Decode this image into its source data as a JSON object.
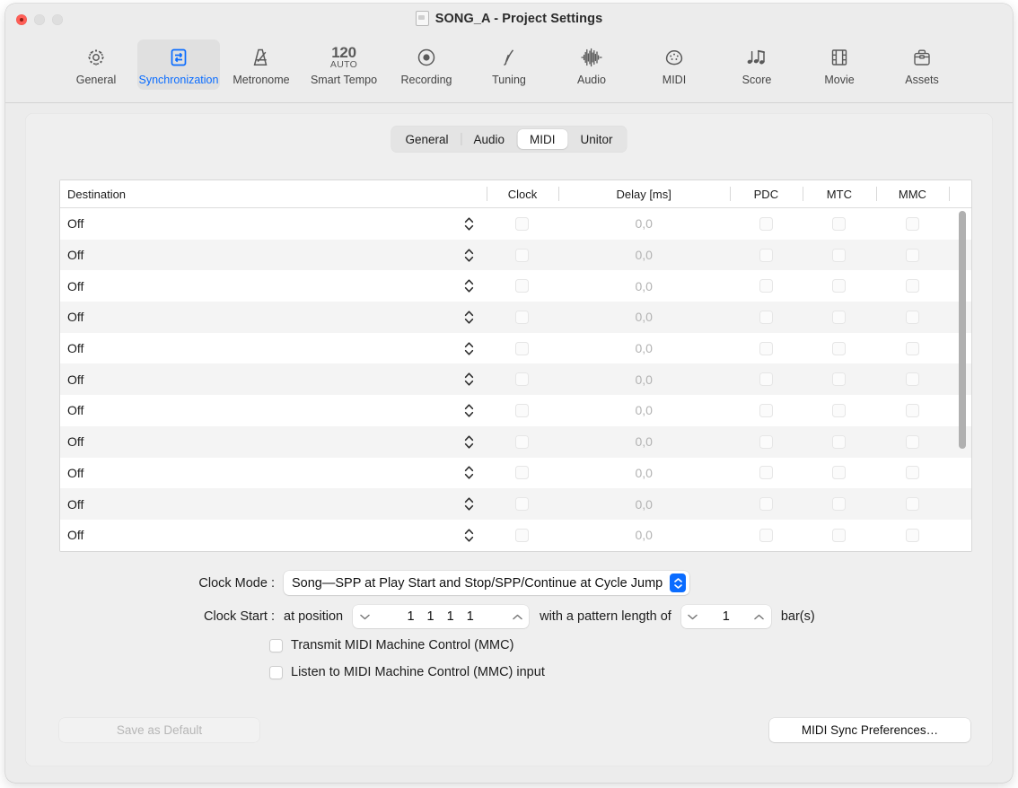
{
  "window": {
    "title": "SONG_A - Project Settings",
    "doc_icon": "document-icon"
  },
  "toolbar": {
    "items": [
      {
        "label": "General",
        "icon": "gear-icon",
        "selected": false
      },
      {
        "label": "Synchronization",
        "icon": "sync-arrows-icon",
        "selected": true
      },
      {
        "label": "Metronome",
        "icon": "metronome-icon",
        "selected": false
      },
      {
        "label": "Smart Tempo",
        "icon": "tempo-icon",
        "selected": false,
        "tempo_number": "120",
        "tempo_mode": "AUTO"
      },
      {
        "label": "Recording",
        "icon": "record-circle-icon",
        "selected": false
      },
      {
        "label": "Tuning",
        "icon": "tuning-fork-icon",
        "selected": false
      },
      {
        "label": "Audio",
        "icon": "waveform-icon",
        "selected": false
      },
      {
        "label": "MIDI",
        "icon": "midi-port-icon",
        "selected": false
      },
      {
        "label": "Score",
        "icon": "notes-icon",
        "selected": false
      },
      {
        "label": "Movie",
        "icon": "film-icon",
        "selected": false
      },
      {
        "label": "Assets",
        "icon": "briefcase-icon",
        "selected": false
      }
    ]
  },
  "tabs": {
    "items": [
      {
        "label": "General",
        "selected": false
      },
      {
        "label": "Audio",
        "selected": false
      },
      {
        "label": "MIDI",
        "selected": true
      },
      {
        "label": "Unitor",
        "selected": false
      }
    ]
  },
  "table": {
    "columns": [
      "Destination",
      "Clock",
      "Delay [ms]",
      "PDC",
      "MTC",
      "MMC"
    ],
    "rows": [
      {
        "destination": "Off",
        "clock": false,
        "delay": "0,0",
        "pdc": false,
        "mtc": false,
        "mmc": false
      },
      {
        "destination": "Off",
        "clock": false,
        "delay": "0,0",
        "pdc": false,
        "mtc": false,
        "mmc": false
      },
      {
        "destination": "Off",
        "clock": false,
        "delay": "0,0",
        "pdc": false,
        "mtc": false,
        "mmc": false
      },
      {
        "destination": "Off",
        "clock": false,
        "delay": "0,0",
        "pdc": false,
        "mtc": false,
        "mmc": false
      },
      {
        "destination": "Off",
        "clock": false,
        "delay": "0,0",
        "pdc": false,
        "mtc": false,
        "mmc": false
      },
      {
        "destination": "Off",
        "clock": false,
        "delay": "0,0",
        "pdc": false,
        "mtc": false,
        "mmc": false
      },
      {
        "destination": "Off",
        "clock": false,
        "delay": "0,0",
        "pdc": false,
        "mtc": false,
        "mmc": false
      },
      {
        "destination": "Off",
        "clock": false,
        "delay": "0,0",
        "pdc": false,
        "mtc": false,
        "mmc": false
      },
      {
        "destination": "Off",
        "clock": false,
        "delay": "0,0",
        "pdc": false,
        "mtc": false,
        "mmc": false
      },
      {
        "destination": "Off",
        "clock": false,
        "delay": "0,0",
        "pdc": false,
        "mtc": false,
        "mmc": false
      },
      {
        "destination": "Off",
        "clock": false,
        "delay": "0,0",
        "pdc": false,
        "mtc": false,
        "mmc": false
      }
    ]
  },
  "clock_mode": {
    "label": "Clock Mode :",
    "value": "Song—SPP at Play Start and Stop/SPP/Continue at Cycle Jump"
  },
  "clock_start": {
    "label": "Clock Start :",
    "prefix": "at position",
    "position_value": "1 1 1 1",
    "middle": "with a pattern length of",
    "length_value": "1",
    "suffix": "bar(s)"
  },
  "checkboxes": [
    {
      "label": "Transmit MIDI Machine Control (MMC)",
      "checked": false
    },
    {
      "label": "Listen to MIDI Machine Control (MMC) input",
      "checked": false
    }
  ],
  "buttons": {
    "save_as_default": "Save as Default",
    "save_as_default_enabled": false,
    "midi_sync_prefs": "MIDI Sync Preferences…",
    "midi_sync_prefs_enabled": true
  },
  "colors": {
    "accent": "#0a6cff",
    "window_bg": "#ececec",
    "panel_bg": "#efefef",
    "row_alt": "#f4f4f4",
    "close_button": "#ff5f57"
  }
}
